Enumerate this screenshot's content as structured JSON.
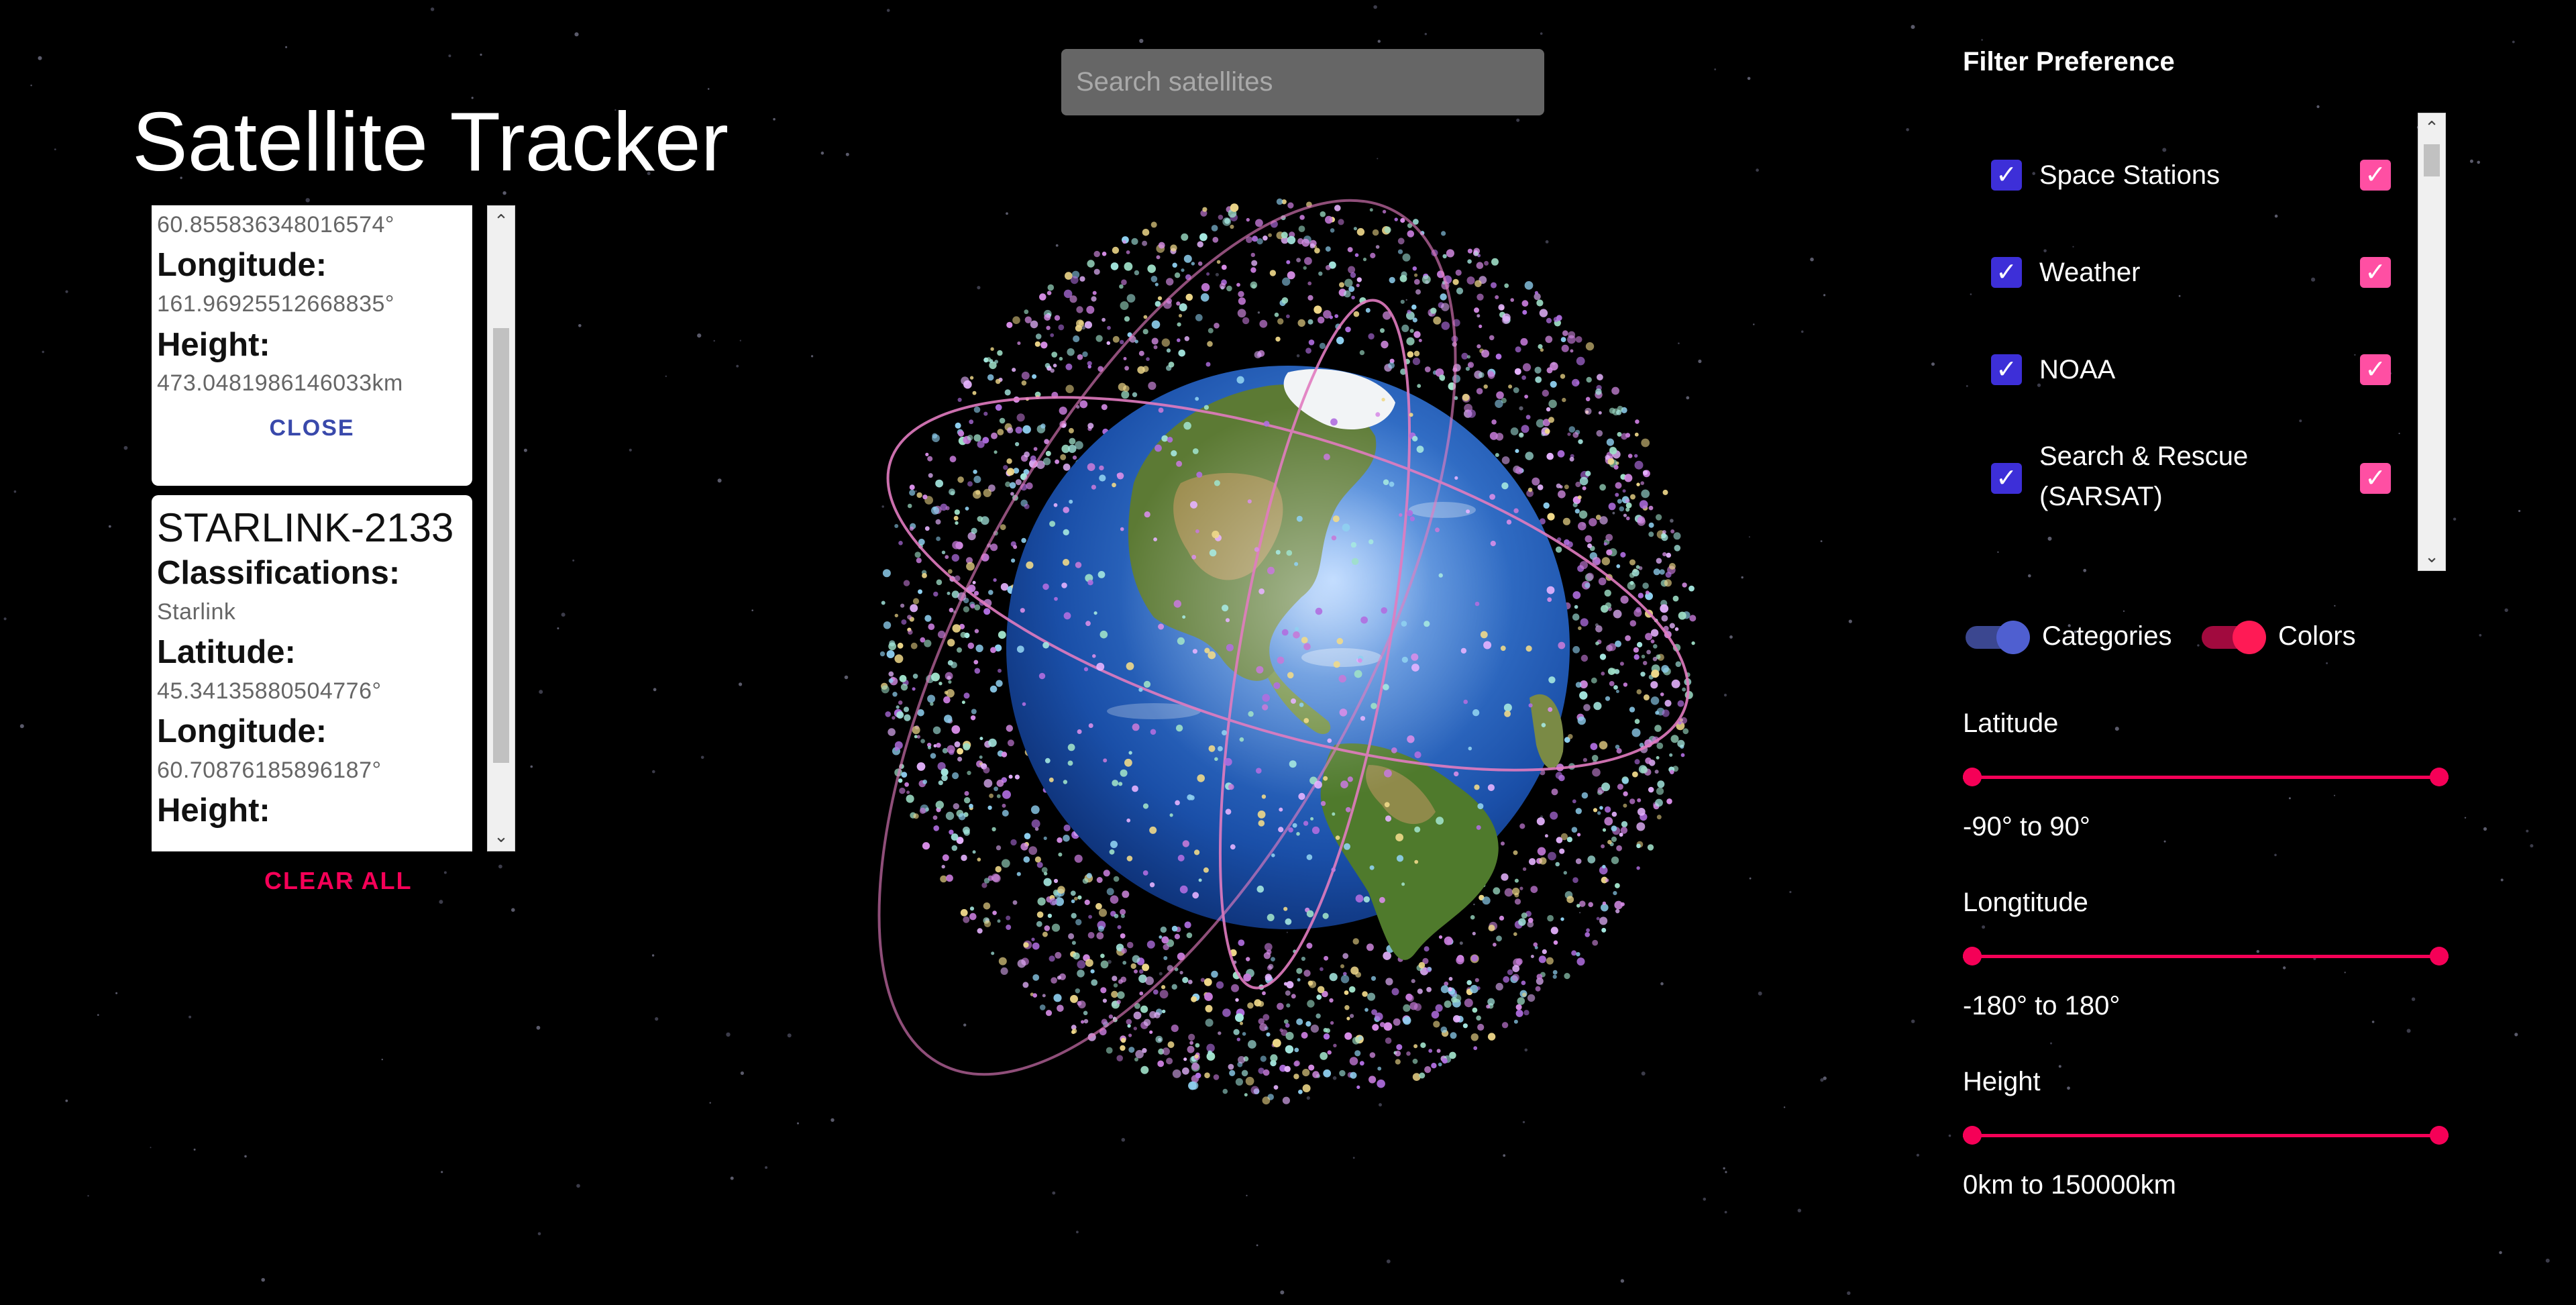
{
  "app": {
    "title": "Satellite Tracker"
  },
  "search": {
    "placeholder": "Search satellites",
    "value": ""
  },
  "selected_satellites": [
    {
      "name": "",
      "latitude_value": "60.855836348016574°",
      "longitude_label": "Longitude:",
      "longitude_value": "161.96925512668835°",
      "height_label": "Height:",
      "height_value": "473.0481986146033km",
      "close_label": "CLOSE"
    },
    {
      "name": "STARLINK-2133",
      "classifications_label": "Classifications:",
      "classification_value": "Starlink",
      "latitude_label": "Latitude:",
      "latitude_value": "45.34135880504776°",
      "longitude_label": "Longitude:",
      "longitude_value": "60.70876185896187°",
      "height_label": "Height:"
    }
  ],
  "clear_all_label": "CLEAR ALL",
  "filter": {
    "title": "Filter Preference",
    "items": [
      {
        "label": "Space Stations",
        "checked_category": true,
        "checked_color": true
      },
      {
        "label": "Weather",
        "checked_category": true,
        "checked_color": true
      },
      {
        "label": "NOAA",
        "checked_category": true,
        "checked_color": true
      },
      {
        "label": "Search & Rescue (SARSAT)",
        "label_line1": "Search & Rescue",
        "label_line2": "(SARSAT)",
        "checked_category": true,
        "checked_color": true
      }
    ]
  },
  "toggles": {
    "categories": {
      "label": "Categories",
      "on": true
    },
    "colors": {
      "label": "Colors",
      "on": true
    }
  },
  "sliders": {
    "latitude": {
      "label": "Latitude",
      "range_text": "-90° to 90°",
      "min": -90,
      "max": 90
    },
    "longitude": {
      "label": "Longtitude",
      "range_text": "-180° to 180°",
      "min": -180,
      "max": 180
    },
    "height": {
      "label": "Height",
      "range_text": "0km to 150000km",
      "min": 0,
      "max": 150000
    }
  },
  "colors": {
    "accent_pink": "#f50057",
    "checkbox_blue": "#3d2fd8",
    "checkbox_pink": "#ff4fa3",
    "orbit_pink": "#e27cc0"
  }
}
